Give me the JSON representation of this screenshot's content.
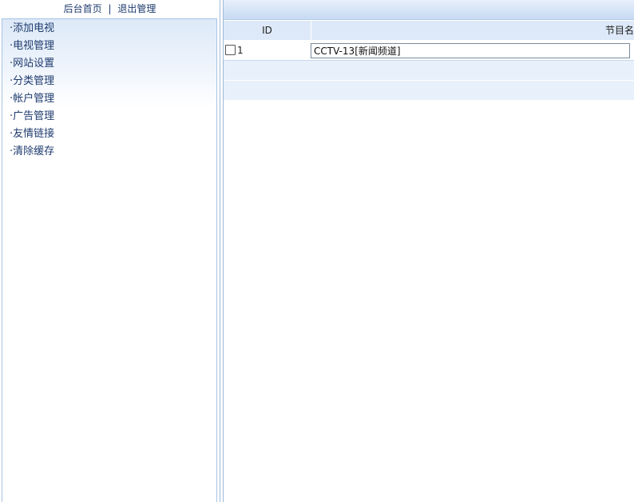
{
  "top_links": {
    "home": "后台首页",
    "separator": "|",
    "logout": "退出管理"
  },
  "menu": {
    "items": [
      {
        "label": "·添加电视"
      },
      {
        "label": "·电视管理"
      },
      {
        "label": "·网站设置"
      },
      {
        "label": "·分类管理"
      },
      {
        "label": "·帐户管理"
      },
      {
        "label": "·广告管理"
      },
      {
        "label": "·友情链接"
      },
      {
        "label": "·清除缓存"
      }
    ]
  },
  "table": {
    "headers": {
      "id": "ID",
      "name": "节目名"
    },
    "rows": [
      {
        "id": "1",
        "name": "CCTV-13[新闻频道]",
        "checked": false
      }
    ]
  },
  "colors": {
    "link": "#1e3b6e",
    "panel_border": "#a7c3e6",
    "header_bg": "#dde9f8",
    "empty_row_bg": "#e8f0fb"
  }
}
